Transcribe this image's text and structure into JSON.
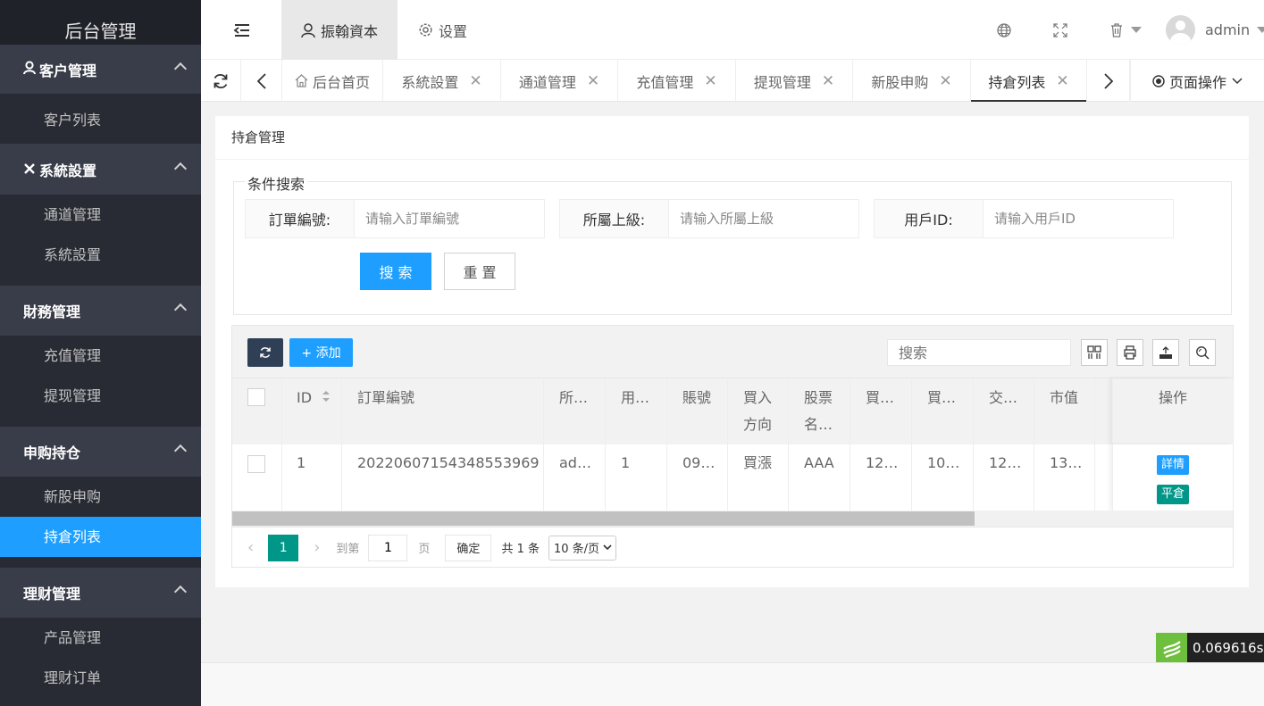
{
  "app": {
    "title": "后台管理"
  },
  "sidebar": {
    "groups": [
      {
        "label": "客户管理",
        "icon": "user-icon",
        "items": [
          "客户列表"
        ]
      },
      {
        "label": "系統設置",
        "icon": "tools-icon",
        "items": [
          "通道管理",
          "系統設置"
        ]
      },
      {
        "label": "財務管理",
        "icon": "",
        "items": [
          "充值管理",
          "提现管理"
        ]
      },
      {
        "label": "申购持仓",
        "icon": "",
        "items": [
          "新股申购",
          "持倉列表"
        ]
      },
      {
        "label": "理财管理",
        "icon": "",
        "items": [
          "产品管理",
          "理财订单"
        ]
      }
    ],
    "active_item": "持倉列表"
  },
  "header": {
    "menu_icon": "menu-fold-icon",
    "account_label": "振翰資本",
    "settings_label": "设置",
    "user_name": "admin",
    "icons": [
      "globe-icon",
      "fullscreen-icon",
      "trash-icon",
      "avatar"
    ]
  },
  "tabs": {
    "items": [
      "后台首页",
      "系統設置",
      "通道管理",
      "充值管理",
      "提现管理",
      "新股申购",
      "持倉列表"
    ],
    "active": "持倉列表",
    "page_ops_label": "页面操作"
  },
  "card": {
    "title": "持倉管理"
  },
  "search": {
    "legend": "条件搜索",
    "fields": [
      {
        "label": "訂單編號:",
        "placeholder": "请输入訂單編號"
      },
      {
        "label": "所屬上級:",
        "placeholder": "请输入所屬上級"
      },
      {
        "label": "用戶ID:",
        "placeholder": "请输入用戶ID"
      }
    ],
    "search_button": "搜 索",
    "reset_button": "重 置"
  },
  "table": {
    "add_label": "+ 添加",
    "search_placeholder": "搜索",
    "columns": [
      "ID",
      "訂單編號",
      "所…",
      "用…",
      "賬號",
      "買入方向",
      "股票名…",
      "買…",
      "買…",
      "交…",
      "市值",
      "",
      "操作"
    ],
    "rows": [
      {
        "id": "1",
        "order_no": "20220607154348553969",
        "parent": "ad…",
        "user": "1",
        "account": "09…",
        "direction": "買漲",
        "stock": "AAA",
        "c7": "12…",
        "c8": "10…",
        "c9": "12…",
        "market": "13…"
      }
    ],
    "actions": {
      "detail": "詳情",
      "close": "平倉"
    },
    "detail_color": "#1e9fff",
    "close_color": "#009688"
  },
  "pager": {
    "current_page": "1",
    "goto_label": "到第",
    "goto_value": "1",
    "page_unit": "页",
    "confirm_label": "确定",
    "total_label": "共 1 条",
    "page_size": "10 条/页"
  },
  "timer": {
    "value": "0.069616s"
  }
}
